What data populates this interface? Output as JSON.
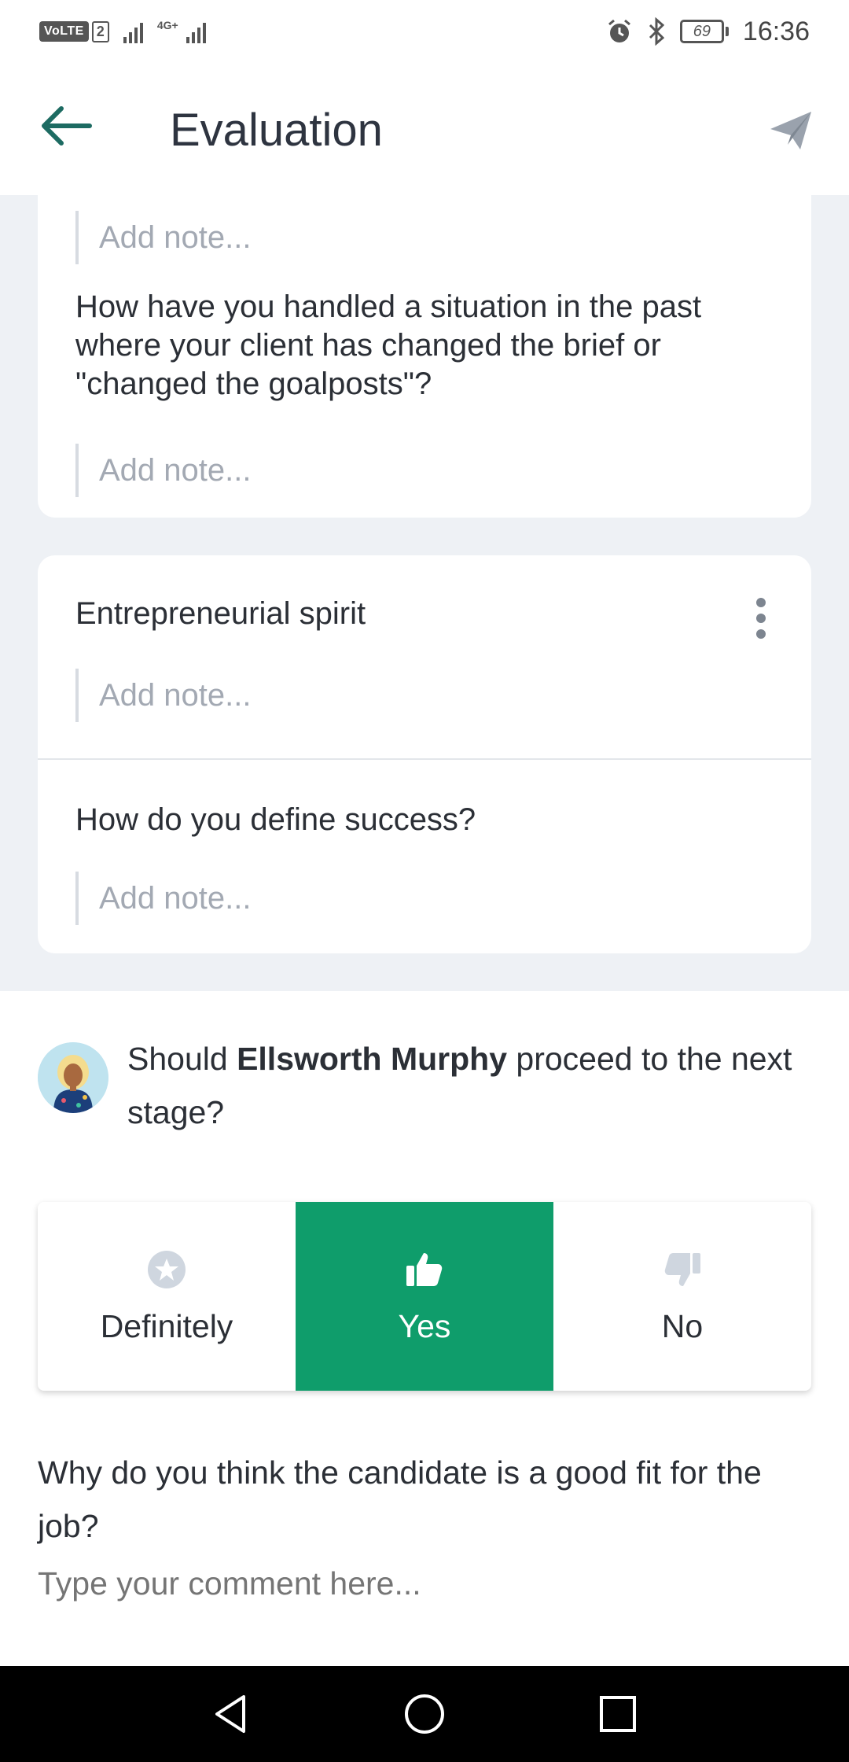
{
  "status_bar": {
    "volte_label": "VoLTE",
    "sim_slot": "2",
    "network_tag": "4G+",
    "battery_level": "69",
    "time": "16:36"
  },
  "app_bar": {
    "title": "Evaluation",
    "icons": [
      "back-arrow-icon",
      "send-icon"
    ]
  },
  "card_1": {
    "top_note_placeholder": "Add note...",
    "question": "How have you handled a situation in the past where your client has changed the brief or \"changed the goalposts\"?",
    "question_note_placeholder": "Add note..."
  },
  "card_2": {
    "section_title": "Entrepreneurial spirit",
    "section_note_placeholder": "Add note...",
    "question": "How do you define success?",
    "question_note_placeholder": "Add note..."
  },
  "decision": {
    "prompt_prefix": "Should ",
    "candidate_name": "Ellsworth Murphy",
    "prompt_suffix": " proceed to the next stage?",
    "options": [
      {
        "label": "Definitely",
        "icon": "star-badge-icon",
        "selected": false
      },
      {
        "label": "Yes",
        "icon": "thumbs-up-icon",
        "selected": true
      },
      {
        "label": "No",
        "icon": "thumbs-down-icon",
        "selected": false
      }
    ],
    "selected_color": "#0f9d6b"
  },
  "comment": {
    "question": "Why do you think the candidate is a good fit for the job?",
    "placeholder": "Type your comment here..."
  },
  "colors": {
    "background_gray": "#eef1f5",
    "accent_green": "#0f9d6b",
    "back_arrow": "#1d6b62"
  }
}
